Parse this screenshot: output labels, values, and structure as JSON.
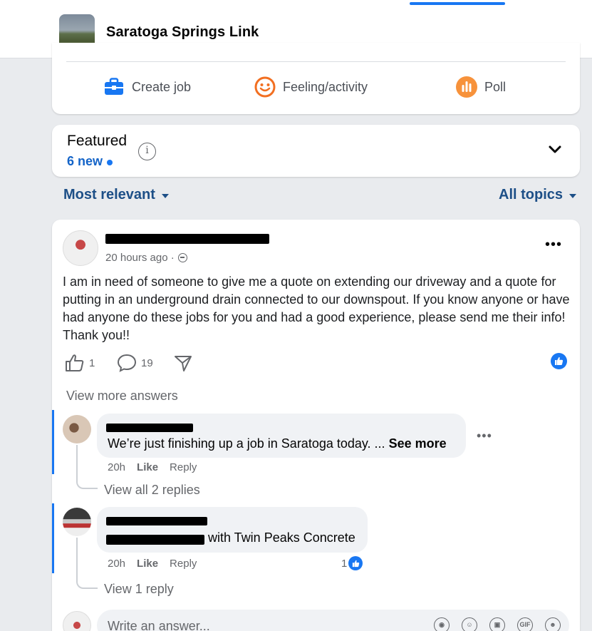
{
  "header": {
    "group_name": "Saratoga Springs Link"
  },
  "composer": {
    "actions": [
      {
        "label": "Create job",
        "icon": "briefcase-icon"
      },
      {
        "label": "Feeling/activity",
        "icon": "smiley-icon"
      },
      {
        "label": "Poll",
        "icon": "poll-icon"
      }
    ]
  },
  "featured": {
    "title": "Featured",
    "new_count": "6 new"
  },
  "sort": {
    "left": "Most relevant",
    "right": "All topics"
  },
  "post": {
    "time": "20 hours ago ·",
    "body": "I am in need of someone to give me a quote on extending our driveway and a quote for putting in an underground drain connected to our downspout. If you know anyone or have had anyone do these jobs for you and had a good experience, please send me their info! Thank you!!",
    "likes": "1",
    "comments": "19",
    "view_more": "View more answers"
  },
  "comments": [
    {
      "text": "We’re just finishing up a job in Saratoga today. ...",
      "see_more": "See more",
      "time": "20h",
      "like": "Like",
      "reply": "Reply",
      "replies": "View all 2 replies"
    },
    {
      "text": "with Twin Peaks Concrete",
      "time": "20h",
      "like": "Like",
      "reply": "Reply",
      "reaction_count": "1",
      "replies": "View 1 reply"
    }
  ],
  "write": {
    "placeholder": "Write an answer...",
    "gif_label": "GIF"
  },
  "colors": {
    "accent": "#1877f2",
    "link_dark": "#1d4f87",
    "orange": "#f7923b"
  }
}
